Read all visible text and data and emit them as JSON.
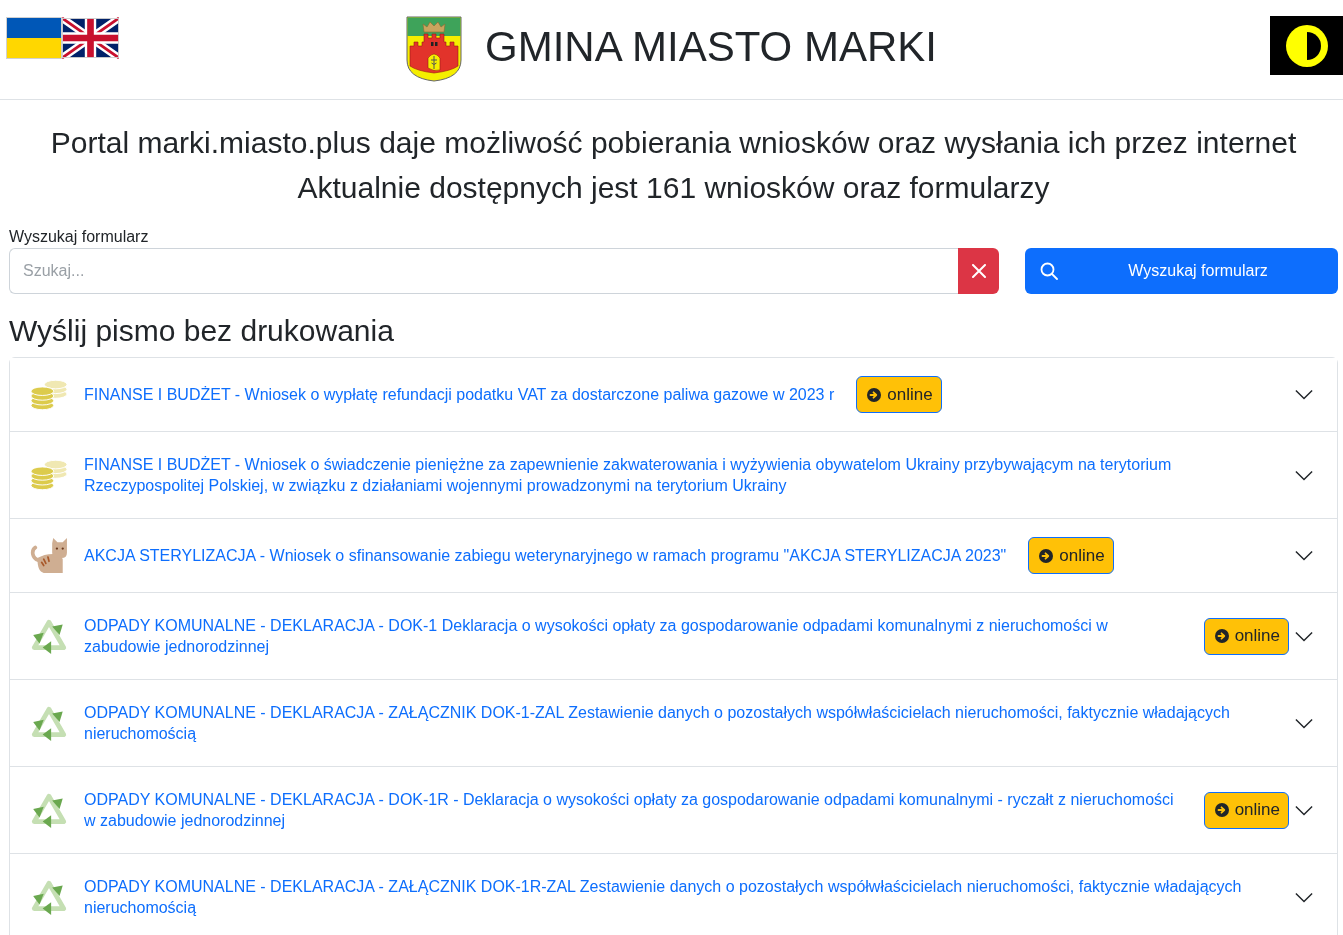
{
  "header": {
    "title": "GMINA MIASTO MARKI"
  },
  "intro": [
    "Portal marki.miasto.plus daje możliwość pobierania wniosków oraz wysłania ich przez internet",
    "Aktualnie dostępnych jest 161 wniosków oraz formularzy"
  ],
  "search": {
    "label": "Wyszukaj formularz",
    "placeholder": "Szukaj...",
    "button": "Wyszukaj formularz"
  },
  "section_title": "Wyślij pismo bez drukowania",
  "forms": [
    {
      "kind": "coins",
      "title": "FINANSE I BUDŻET - Wniosek o wypłatę refundacji podatku VAT za dostarczone paliwa gazowe w 2023 r",
      "badge": "online",
      "expanded": false
    },
    {
      "kind": "coins",
      "title": "FINANSE I BUDŻET - Wniosek o świadczenie pieniężne za zapewnienie zakwaterowania i wyżywienia obywatelom Ukrainy przybywającym na terytorium Rzeczypospolitej Polskiej, w związku z działaniami wojennymi prowadzonymi na terytorium Ukrainy",
      "expanded": false
    },
    {
      "kind": "cat",
      "title": "AKCJA STERYLIZACJA - Wniosek o sfinansowanie zabiegu weterynaryjnego w ramach programu \"AKCJA STERYLIZACJA 2023\"",
      "badge": "online",
      "expanded": false
    },
    {
      "kind": "recycle",
      "title": "ODPADY KOMUNALNE - DEKLARACJA - DOK-1 Deklaracja o wysokości opłaty za gospodarowanie odpadami komunalnymi z nieruchomości w zabudowie jednorodzinnej",
      "badge": "online",
      "expanded": false
    },
    {
      "kind": "recycle",
      "title": "ODPADY KOMUNALNE - DEKLARACJA - ZAŁĄCZNIK DOK-1-ZAL Zestawienie danych o pozostałych współwłaścicielach nieruchomości, faktycznie władających nieruchomością",
      "expanded": false
    },
    {
      "kind": "recycle",
      "title": "ODPADY KOMUNALNE - DEKLARACJA - DOK-1R - Deklaracja o wysokości opłaty za gospodarowanie odpadami komunalnymi - ryczałt z nieruchomości w zabudowie jednorodzinnej",
      "badge": "online",
      "expanded": false
    },
    {
      "kind": "recycle",
      "title": "ODPADY KOMUNALNE - DEKLARACJA - ZAŁĄCZNIK DOK-1R-ZAL Zestawienie danych o pozostałych współwłaścicielach nieruchomości, faktycznie władających nieruchomością",
      "expanded": false
    }
  ]
}
